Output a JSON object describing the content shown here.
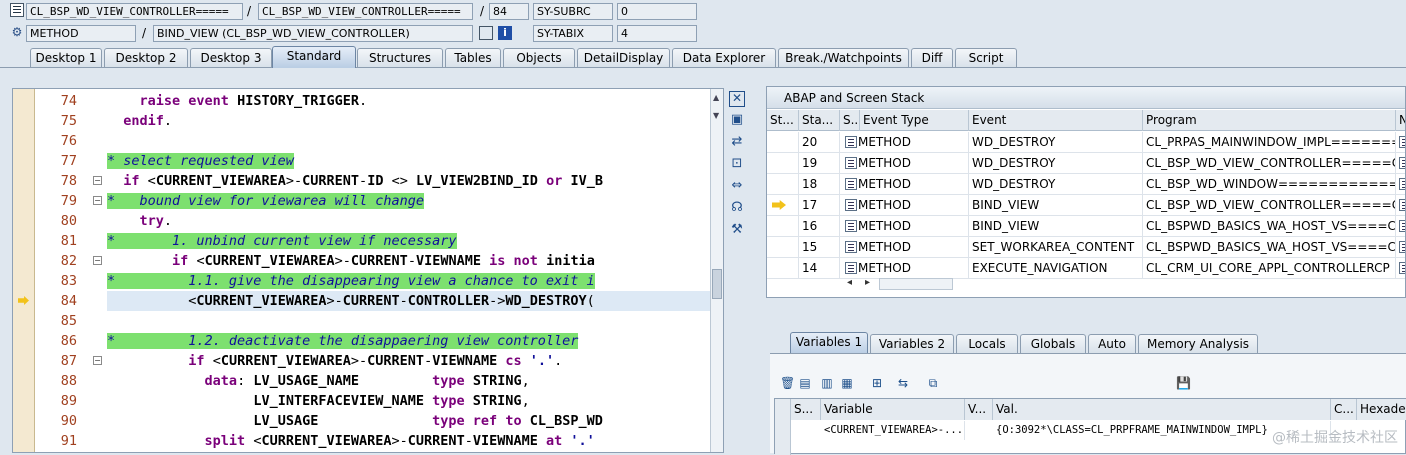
{
  "header": {
    "row1": {
      "class1": "CL_BSP_WD_VIEW_CONTROLLER=====",
      "class2": "CL_BSP_WD_VIEW_CONTROLLER=====",
      "line": "84",
      "sysvar": "SY-SUBRC",
      "sysval": "0"
    },
    "row2": {
      "type": "METHOD",
      "name": "BIND_VIEW (CL_BSP_WD_VIEW_CONTROLLER)",
      "sysvar": "SY-TABIX",
      "sysval": "4"
    },
    "sep": "/"
  },
  "tabs": [
    "Desktop 1",
    "Desktop 2",
    "Desktop 3",
    "Standard",
    "Structures",
    "Tables",
    "Objects",
    "DetailDisplay",
    "Data Explorer",
    "Break./Watchpoints",
    "Diff",
    "Script"
  ],
  "source_lines": [
    {
      "n": "74",
      "t": "    raise event HISTORY_TRIGGER."
    },
    {
      "n": "75",
      "t": "  endif."
    },
    {
      "n": "76",
      "t": ""
    },
    {
      "n": "77",
      "t": "* select requested view"
    },
    {
      "n": "78",
      "t": "  if <CURRENT_VIEWAREA>-CURRENT-ID <> LV_VIEW2BIND_ID or IV_B"
    },
    {
      "n": "79",
      "t": "*   bound view for viewarea will change"
    },
    {
      "n": "80",
      "t": "    try."
    },
    {
      "n": "81",
      "t": "*       1. unbind current view if necessary"
    },
    {
      "n": "82",
      "t": "        if <CURRENT_VIEWAREA>-CURRENT-VIEWNAME is not initia"
    },
    {
      "n": "83",
      "t": "*         1.1. give the disappearing view a chance to exit i"
    },
    {
      "n": "84",
      "t": "          <CURRENT_VIEWAREA>-CURRENT-CONTROLLER->WD_DESTROY("
    },
    {
      "n": "85",
      "t": ""
    },
    {
      "n": "86",
      "t": "*         1.2. deactivate the disappaering view controller"
    },
    {
      "n": "87",
      "t": "          if <CURRENT_VIEWAREA>-CURRENT-VIEWNAME cs '.'."
    },
    {
      "n": "88",
      "t": "            data: LV_USAGE_NAME         type STRING,"
    },
    {
      "n": "89",
      "t": "                  LV_INTERFACEVIEW_NAME type STRING,"
    },
    {
      "n": "90",
      "t": "                  LV_USAGE              type ref to CL_BSP_WD"
    },
    {
      "n": "91",
      "t": "            split <CURRENT_VIEWAREA>-CURRENT-VIEWNAME at '.' "
    }
  ],
  "stack": {
    "title": "ABAP and Screen Stack",
    "columns": [
      "St...",
      "Sta...",
      "S...",
      "Event Type",
      "Event",
      "Program",
      "Na"
    ],
    "rows": [
      {
        "level": "20",
        "etype": "METHOD",
        "event": "WD_DESTROY",
        "program": "CL_PRPAS_MAINWINDOW_IMPL=======CP",
        "current": false
      },
      {
        "level": "19",
        "etype": "METHOD",
        "event": "WD_DESTROY",
        "program": "CL_BSP_WD_VIEW_CONTROLLER=====CP",
        "current": false
      },
      {
        "level": "18",
        "etype": "METHOD",
        "event": "WD_DESTROY",
        "program": "CL_BSP_WD_WINDOW============...",
        "current": false
      },
      {
        "level": "17",
        "etype": "METHOD",
        "event": "BIND_VIEW",
        "program": "CL_BSP_WD_VIEW_CONTROLLER=====CP",
        "current": true
      },
      {
        "level": "16",
        "etype": "METHOD",
        "event": "BIND_VIEW",
        "program": "CL_BSPWD_BASICS_WA_HOST_VS====CP",
        "current": false
      },
      {
        "level": "15",
        "etype": "METHOD",
        "event": "SET_WORKAREA_CONTENT",
        "program": "CL_BSPWD_BASICS_WA_HOST_VS====CP",
        "current": false
      },
      {
        "level": "14",
        "etype": "METHOD",
        "event": "EXECUTE_NAVIGATION",
        "program": "CL_CRM_UI_CORE_APPL_CONTROLLERCP",
        "current": false
      }
    ]
  },
  "var_tabs": [
    "Variables 1",
    "Variables 2",
    "Locals",
    "Globals",
    "Auto",
    "Memory Analysis"
  ],
  "vars": {
    "columns": [
      "S...",
      "Variable",
      "V...",
      "Val.",
      "C...",
      "Hexadeci"
    ],
    "row": {
      "variable": "<CURRENT_VIEWAREA>-...",
      "value": "{O:3092*\\CLASS=CL_PRPFRAME_MAINWINDOW_IMPL}"
    }
  },
  "watermark": "@稀土掘金技术社区",
  "colors": {
    "comment_bg": "#7de06f",
    "keyword": "#7a007a",
    "active_tab": "#b9cde4"
  }
}
